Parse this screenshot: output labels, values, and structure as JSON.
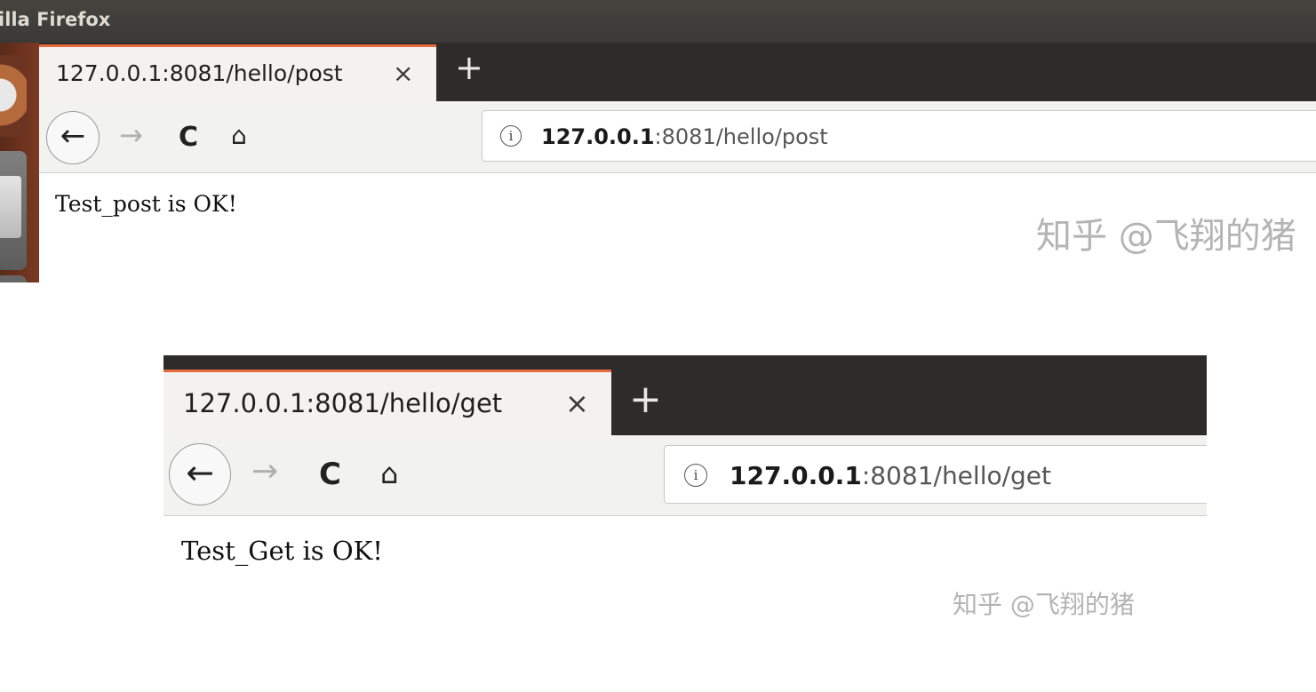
{
  "window": {
    "title": "illa Firefox"
  },
  "top_browser": {
    "tab": {
      "title": "127.0.0.1:8081/hello/post",
      "close": "×"
    },
    "new_tab": "+",
    "nav": {
      "back": "←",
      "forward": "→",
      "reload": "C",
      "home": "⌂"
    },
    "url": {
      "info": "i",
      "host": "127.0.0.1",
      "path": ":8081/hello/post"
    },
    "page_text": "Test_post is OK!",
    "watermark": "知乎 @飞翔的猪"
  },
  "bottom_browser": {
    "tab": {
      "title": "127.0.0.1:8081/hello/get",
      "close": "×"
    },
    "new_tab": "+",
    "nav": {
      "back": "←",
      "forward": "→",
      "reload": "C",
      "home": "⌂"
    },
    "url": {
      "info": "i",
      "host": "127.0.0.1",
      "path": ":8081/hello/get"
    },
    "page_text": "Test_Get is OK!",
    "watermark": "知乎 @飞翔的猪"
  },
  "colors": {
    "titlebar": "#3f3e3a",
    "tab_accent": "#e66a3a",
    "tabstrip": "#2d2c2a",
    "launcher": "#6b3420"
  },
  "icons": {
    "launcher": [
      "firefox-icon",
      "files-icon",
      "terminal-icon"
    ],
    "nav": [
      "back-arrow-icon",
      "forward-arrow-icon",
      "reload-icon",
      "home-icon",
      "info-icon"
    ]
  }
}
